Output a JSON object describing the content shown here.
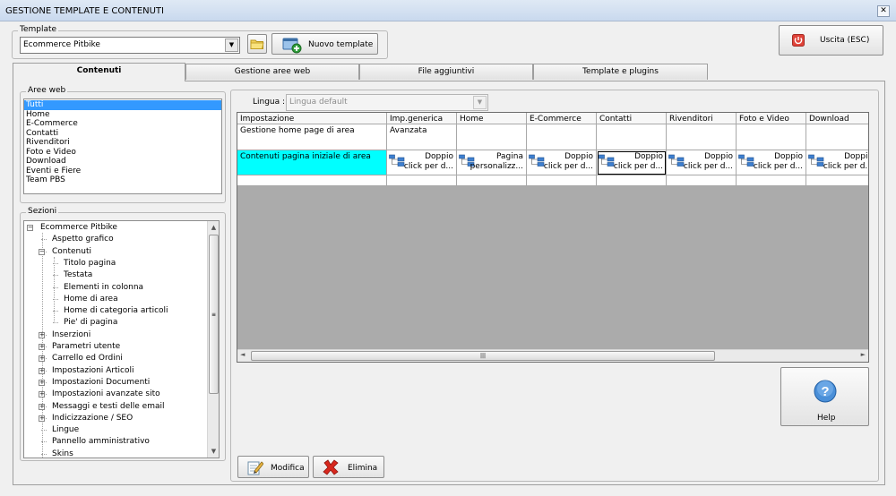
{
  "window": {
    "title": "GESTIONE TEMPLATE E CONTENUTI",
    "close_glyph": "✕"
  },
  "template": {
    "legend": "Template",
    "selected": "Ecommerce Pitbike",
    "folder_icon": "folder-icon",
    "new_button": "Nuovo template"
  },
  "exit_button": "Uscita (ESC)",
  "tabs": [
    {
      "label": "Contenuti",
      "active": true
    },
    {
      "label": "Gestione aree web",
      "active": false
    },
    {
      "label": "File aggiuntivi",
      "active": false
    },
    {
      "label": "Template e plugins",
      "active": false
    }
  ],
  "aree_web": {
    "legend": "Aree web",
    "items": [
      "Tutti",
      "Home",
      "E-Commerce",
      "Contatti",
      "Rivenditori",
      "Foto e Video",
      "Download",
      "Eventi e Fiere",
      "Team PBS"
    ],
    "selected_index": 0
  },
  "sezioni": {
    "legend": "Sezioni",
    "tree": [
      {
        "label": "Ecommerce Pitbike",
        "level": 0,
        "expander": "−"
      },
      {
        "label": "Aspetto grafico",
        "level": 1,
        "expander": ""
      },
      {
        "label": "Contenuti",
        "level": 1,
        "expander": "−"
      },
      {
        "label": "Titolo pagina",
        "level": 2,
        "expander": ""
      },
      {
        "label": "Testata",
        "level": 2,
        "expander": ""
      },
      {
        "label": "Elementi in colonna",
        "level": 2,
        "expander": ""
      },
      {
        "label": "Home di area",
        "level": 2,
        "expander": ""
      },
      {
        "label": "Home di categoria articoli",
        "level": 2,
        "expander": ""
      },
      {
        "label": "Pie' di pagina",
        "level": 2,
        "expander": ""
      },
      {
        "label": "Inserzioni",
        "level": 1,
        "expander": "+"
      },
      {
        "label": "Parametri utente",
        "level": 1,
        "expander": "+"
      },
      {
        "label": "Carrello ed Ordini",
        "level": 1,
        "expander": "+"
      },
      {
        "label": "Impostazioni Articoli",
        "level": 1,
        "expander": "+"
      },
      {
        "label": "Impostazioni Documenti",
        "level": 1,
        "expander": "+"
      },
      {
        "label": "Impostazioni avanzate sito",
        "level": 1,
        "expander": "+"
      },
      {
        "label": "Messaggi e testi delle email",
        "level": 1,
        "expander": "+"
      },
      {
        "label": "Indicizzazione / SEO",
        "level": 1,
        "expander": "+"
      },
      {
        "label": "Lingue",
        "level": 1,
        "expander": ""
      },
      {
        "label": "Pannello amministrativo",
        "level": 1,
        "expander": ""
      },
      {
        "label": "Skins",
        "level": 1,
        "expander": ""
      }
    ]
  },
  "lingua": {
    "label": "Lingua :",
    "placeholder": "Lingua default"
  },
  "grid": {
    "columns": [
      "Impostazione",
      "Imp.generica",
      "Home",
      "E-Commerce",
      "Contatti",
      "Rivenditori",
      "Foto e Video",
      "Download"
    ],
    "rows": [
      {
        "setting": "Gestione home page di area",
        "generic": "Avanzata",
        "cells": [
          "",
          "",
          "",
          "",
          "",
          ""
        ]
      },
      {
        "setting": "Contenuti pagina iniziale di area",
        "generic": "Doppio\nclick per d...",
        "cells": [
          "Pagina\npersonalizz...",
          "Doppio\nclick per d...",
          "Doppio\nclick per d...",
          "Doppio\nclick per d...",
          "Doppio\nclick per d...",
          "Doppio\nclick per d..."
        ]
      }
    ]
  },
  "modifica_button": "Modifica",
  "elimina_button": "Elimina",
  "help_button": "Help",
  "colors": {
    "selection": "#3399ff",
    "row_highlight": "#00ffff",
    "grid_background": "#ababab"
  }
}
